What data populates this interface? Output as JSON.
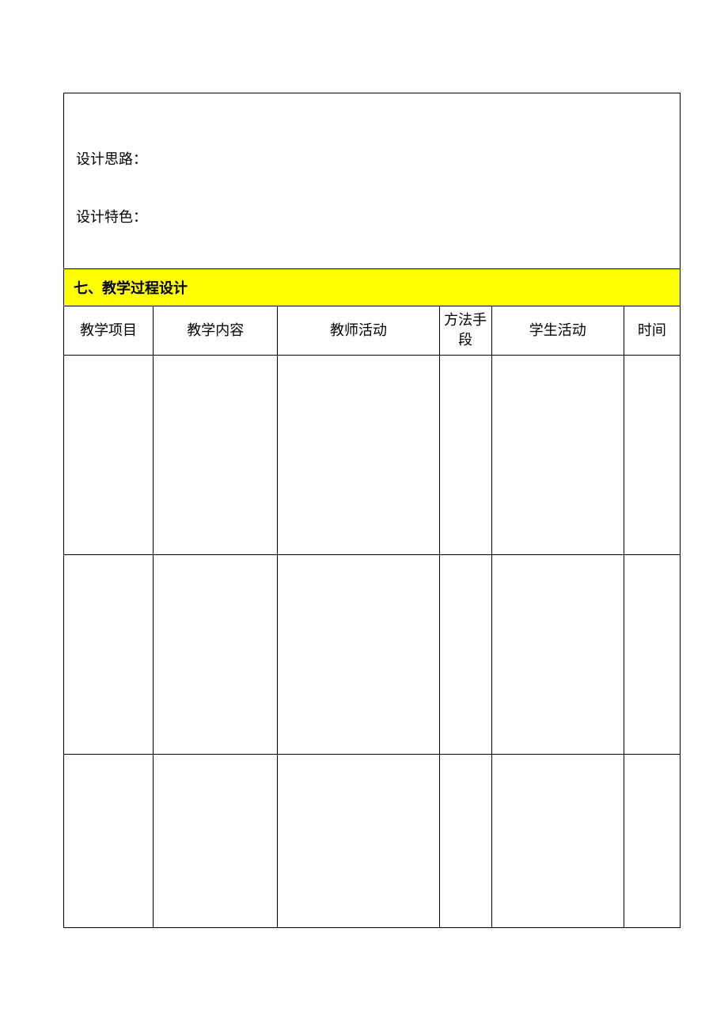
{
  "topSection": {
    "line1": "设计思路：",
    "line2": "设计特色："
  },
  "sectionHeader": "七、教学过程设计",
  "table": {
    "headers": {
      "col1": "教学项目",
      "col2": "教学内容",
      "col3": "教师活动",
      "col4": "方法手段",
      "col5": "学生活动",
      "col6": "时间"
    },
    "rows": [
      {
        "col1": "",
        "col2": "",
        "col3": "",
        "col4": "",
        "col5": "",
        "col6": ""
      },
      {
        "col1": "",
        "col2": "",
        "col3": "",
        "col4": "",
        "col5": "",
        "col6": ""
      },
      {
        "col1": "",
        "col2": "",
        "col3": "",
        "col4": "",
        "col5": "",
        "col6": ""
      }
    ]
  }
}
